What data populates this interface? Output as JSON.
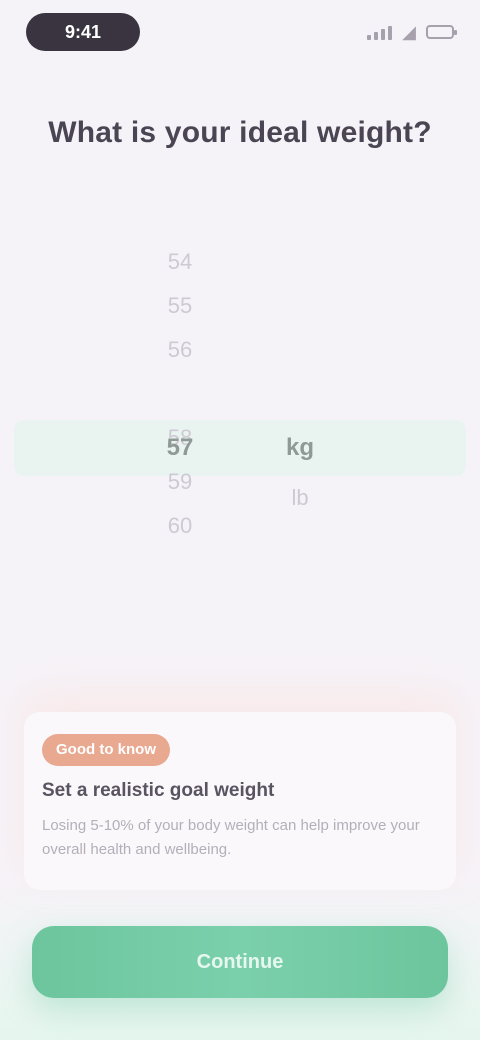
{
  "status_bar": {
    "time": "9:41"
  },
  "screen": {
    "question": "What is your ideal weight?"
  },
  "picker": {
    "whole": [
      "54",
      "55",
      "56",
      "57",
      "58",
      "59",
      "60"
    ],
    "unit": [
      "kg",
      "lb"
    ],
    "selected_whole": "57",
    "selected_unit": "kg"
  },
  "tip": {
    "badge": "Good to know",
    "title": "Set a realistic goal weight",
    "body": "Losing 5-10% of your body weight can help improve your overall health and wellbeing."
  },
  "actions": {
    "continue_label": "Continue"
  },
  "colors": {
    "accent": "#6cc59d",
    "badge": "#e9a890",
    "background": "#f6f3f8"
  }
}
